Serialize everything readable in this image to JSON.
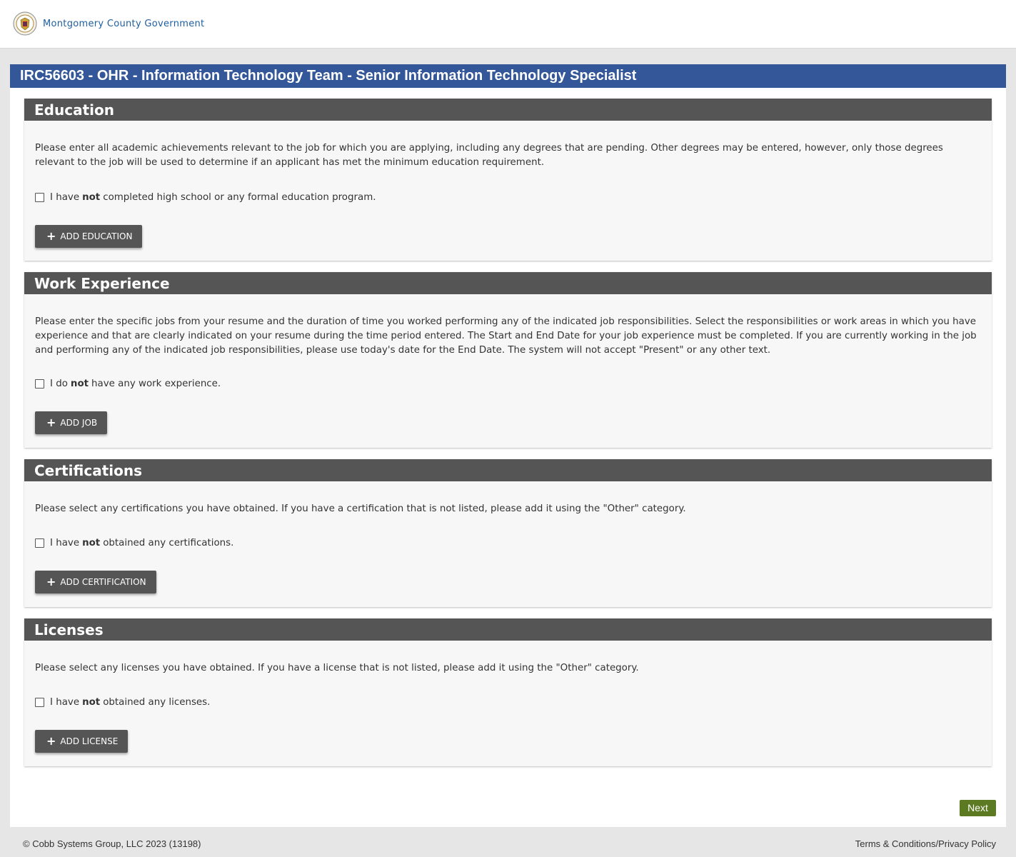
{
  "header": {
    "org_name": "Montgomery County Government",
    "logo_icon": "county-seal-icon"
  },
  "job_title": "IRC56603 - OHR - Information Technology Team - Senior Information Technology Specialist",
  "sections": {
    "education": {
      "title": "Education",
      "description": "Please enter all academic achievements relevant to the job for which you are applying, including any degrees that are pending. Other degrees may be entered, however, only those degrees relevant to the job will be used to determine if an applicant has met the minimum education requirement.",
      "check_pre": "I have",
      "check_bold": "not",
      "check_post": "completed high school or any formal education program.",
      "button": "ADD EDUCATION"
    },
    "work": {
      "title": "Work Experience",
      "description": "Please enter the specific jobs from your resume and the duration of time you worked performing any of the indicated job responsibilities. Select the responsibilities or work areas in which you have experience and that are clearly indicated on your resume during the time period entered. The Start and End Date for your job experience must be completed. If you are currently working in the job and performing any of the indicated job responsibilities, please use today's date for the End Date. The system will not accept \"Present\" or any other text.",
      "check_pre": "I do",
      "check_bold": "not",
      "check_post": "have any work experience.",
      "button": "ADD JOB"
    },
    "certifications": {
      "title": "Certifications",
      "description": "Please select any certifications you have obtained. If you have a certification that is not listed, please add it using the \"Other\" category.",
      "check_pre": "I have",
      "check_bold": "not",
      "check_post": "obtained any certifications.",
      "button": "ADD CERTIFICATION"
    },
    "licenses": {
      "title": "Licenses",
      "description": "Please select any licenses you have obtained. If you have a license that is not listed, please add it using the \"Other\" category.",
      "check_pre": "I have",
      "check_bold": "not",
      "check_post": "obtained any licenses.",
      "button": "ADD LICENSE"
    }
  },
  "next_button": "Next",
  "footer": {
    "copyright": "© Cobb Systems Group, LLC 2023 (13198)",
    "terms": "Terms & Conditions/Privacy Policy"
  },
  "colors": {
    "title_bar": "#335798",
    "section_header": "#555555",
    "next_button": "#5c7a22",
    "brand_text": "#1f5fa0"
  }
}
